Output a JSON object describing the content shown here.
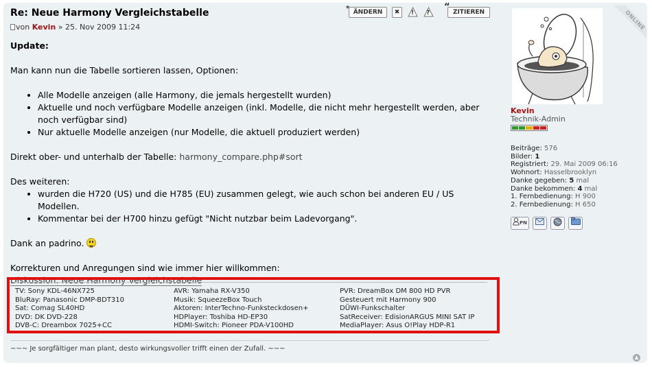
{
  "post": {
    "title": "Re: Neue Harmony Vergleichstabelle",
    "meta_prefix": "von",
    "author": "Kevin",
    "date": "» 25. Nov 2009 11:24"
  },
  "toolbar": {
    "edit_label": "ÄNDERN",
    "delete_label": "✖",
    "report_label": "!",
    "info_label": "?",
    "quote_label": "ZITIEREN"
  },
  "body": {
    "heading": "Update:",
    "intro": "Man kann nun die Tabelle sortieren lassen, Optionen:",
    "options": [
      "Alle Modelle anzeigen (alle Harmony, die jemals hergestellt wurden)",
      "Aktuelle und noch verfügbare Modelle anzeigen (inkl. Modelle, die nicht mehr hergestellt werden, aber noch verfügbar sind)",
      "Nur aktuelle Modelle anzeigen (nur Modelle, die aktuell produziert werden)"
    ],
    "direct_prefix": "Direkt ober- und unterhalb der Tabelle:",
    "direct_link": "harmony_compare.php#sort",
    "further": "Des weiteren:",
    "changes": [
      "wurden die H720 (US) und die H785 (EU) zusammen gelegt, wie auch schon bei anderen EU / US Modellen.",
      "Kommentar bei der H700 hinzu gefügt \"Nicht nutzbar beim Ladevorgang\"."
    ],
    "thanks": "Dank an padrino.",
    "corrections": "Korrekturen und Anregungen sind wie immer hier willkommen:",
    "discussion_link": "Diskussion: Neue Harmony Vergleichstabelle"
  },
  "signature": {
    "col1": [
      "TV: Sony KDL-46NX725",
      "BluRay: Panasonic DMP-BDT310",
      "Sat: Comag SL40HD",
      "DVD: DK DVD-228",
      "DVB-C: Dreambox 7025+CC"
    ],
    "col2": [
      "AVR: Yamaha RX-V350",
      "Musik: SqueezeBox Touch",
      "Aktoren: InterTechno-Funksteckdosen+",
      "HDPlayer: Toshiba HD-EP30",
      "HDMI-Switch: Pioneer PDA-V100HD"
    ],
    "col3": [
      "PVR: DreamBox DM 800 HD PVR",
      "Gesteuert mit Harmony 900",
      "DÜWI-Funkschalter",
      "SatReceiver: EdisionARGUS MINI SAT IP",
      "MediaPlayer: Asus O!Play HDP-R1"
    ],
    "motto": "~~~ Je sorgfältiger man plant, desto wirkungsvoller trifft einen der Zufall. ~~~"
  },
  "user": {
    "online_badge": "ONLINE",
    "name": "Kevin",
    "role": "Technik-Admin",
    "rank_colors": [
      "#2c9a2c",
      "#2c9a2c",
      "#e0b000",
      "#d02020",
      "#d02020"
    ],
    "stats": [
      {
        "label": "Beiträge:",
        "value": "576",
        "bold": false
      },
      {
        "label": "Bilder:",
        "value": "1",
        "bold": true
      },
      {
        "label": "Registriert:",
        "value": "29. Mai 2009 06:16",
        "bold": false
      },
      {
        "label": "Wohnort:",
        "value": "Hasselbrooklyn",
        "bold": false
      },
      {
        "label": "Danke gegeben:",
        "value": "5",
        "suffix": "mal",
        "bold": true
      },
      {
        "label": "Danke bekommen:",
        "value": "4",
        "suffix": "mal",
        "bold": true
      },
      {
        "label": "1. Fernbedienung:",
        "value": "H 900",
        "bold": false
      },
      {
        "label": "2. Fernbedienung:",
        "value": "H 650",
        "bold": false
      }
    ],
    "pm_label": "PN"
  }
}
